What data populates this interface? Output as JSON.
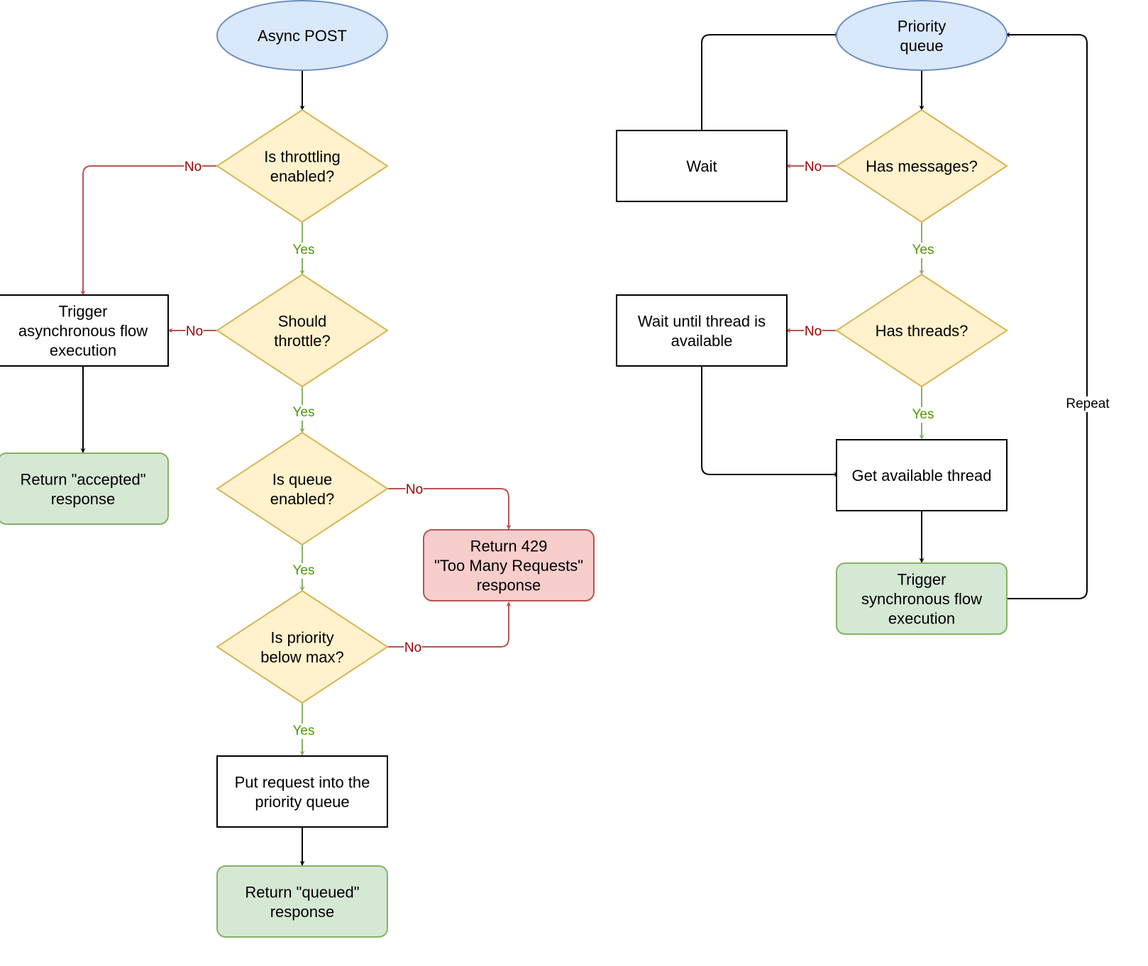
{
  "colors": {
    "start_fill": "#dae8fc",
    "start_stroke": "#6c8ebf",
    "decision_fill": "#fff2cc",
    "decision_stroke": "#d6b656",
    "success_fill": "#d5e8d4",
    "success_stroke": "#82b366",
    "error_fill": "#f8cecc",
    "error_stroke": "#b85450",
    "process_fill": "#ffffff",
    "process_stroke": "#000000",
    "yes_edge": "#82b366",
    "yes_text": "#4d9900",
    "no_edge": "#b85450",
    "no_text": "#990000",
    "default_edge": "#000000"
  },
  "left_flow": {
    "start": [
      "Async POST"
    ],
    "q_throttling": [
      "Is throttling",
      "enabled?"
    ],
    "q_should": [
      "Should",
      "throttle?"
    ],
    "q_queue": [
      "Is queue",
      "enabled?"
    ],
    "q_priority": [
      "Is priority",
      "below max?"
    ],
    "trigger_async": [
      "Trigger",
      "asynchronous flow",
      "execution"
    ],
    "accepted": [
      "Return \"accepted\"",
      "response"
    ],
    "error_429": [
      "Return 429",
      "\"Too Many Requests\"",
      "response"
    ],
    "put_queue": [
      "Put request into the",
      "priority queue"
    ],
    "queued": [
      "Return \"queued\"",
      "response"
    ]
  },
  "right_flow": {
    "start": [
      "Priority",
      "queue"
    ],
    "q_messages": [
      "Has messages?"
    ],
    "q_threads": [
      "Has threads?"
    ],
    "wait": [
      "Wait"
    ],
    "wait_thread": [
      "Wait until thread is",
      "available"
    ],
    "get_thread": [
      "Get available thread"
    ],
    "trigger_sync": [
      "Trigger",
      "synchronous flow",
      "execution"
    ]
  },
  "edge_labels": {
    "yes": "Yes",
    "no": "No",
    "repeat": "Repeat"
  }
}
